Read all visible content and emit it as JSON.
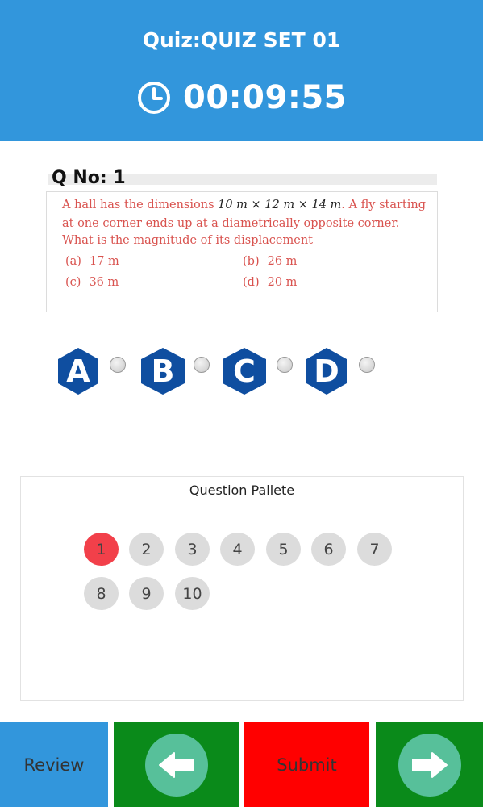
{
  "header": {
    "quiz_title": "Quiz:QUIZ SET 01",
    "timer": "00:09:55",
    "timer_icon": "clock-icon",
    "bg_color": "#3296dc"
  },
  "question": {
    "number_label": "Q No: 1",
    "text_part1": "A hall has the dimensions",
    "math": "10 m × 12 m × 14 m",
    "text_part2": ". A fly starting",
    "line2": "at one corner ends up at a diametrically opposite corner.",
    "line3": "What is the magnitude of its displacement",
    "options": [
      {
        "key": "(a)",
        "value": "17 m"
      },
      {
        "key": "(b)",
        "value": "26 m"
      },
      {
        "key": "(c)",
        "value": "36 m"
      },
      {
        "key": "(d)",
        "value": "20 m"
      }
    ]
  },
  "answer_choices": [
    {
      "letter": "A",
      "selected": false
    },
    {
      "letter": "B",
      "selected": false
    },
    {
      "letter": "C",
      "selected": false
    },
    {
      "letter": "D",
      "selected": false
    }
  ],
  "palette": {
    "title": "Question Pallete",
    "buttons": [
      "1",
      "2",
      "3",
      "4",
      "5",
      "6",
      "7",
      "8",
      "9",
      "10"
    ],
    "current": "1",
    "current_color": "#f2404a"
  },
  "footer": {
    "review_label": "Review",
    "submit_label": "Submit",
    "prev_icon": "arrow-left-icon",
    "next_icon": "arrow-right-icon"
  }
}
